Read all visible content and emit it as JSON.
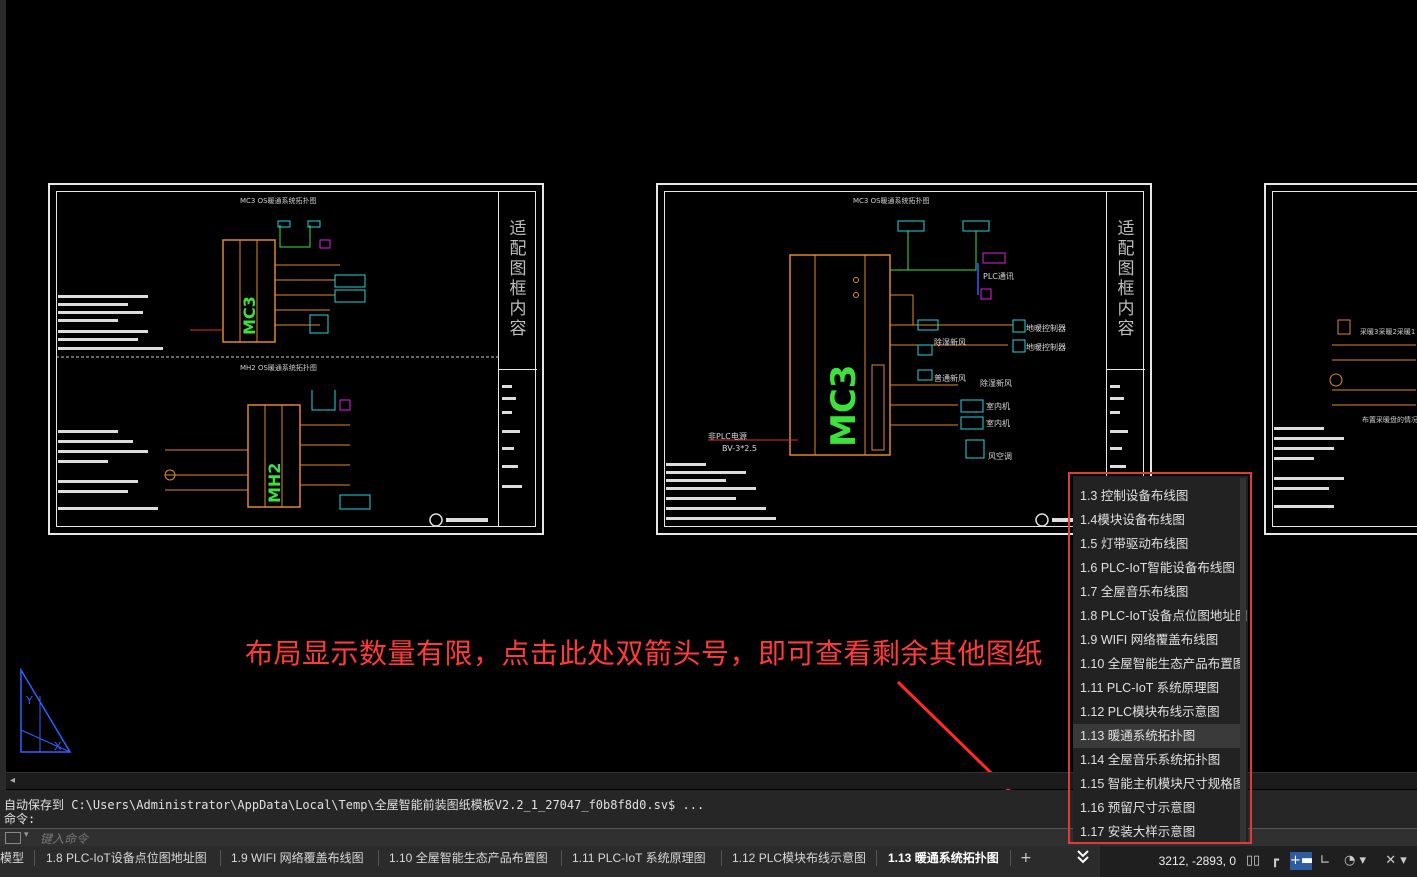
{
  "drawing": {
    "sheet1": {
      "title_top": "MC3 OS暖通系统拓扑图",
      "title_bottom": "MH2 OS暖通系统拓扑图",
      "module_top": "MC3",
      "module_bottom": "MH2",
      "title_column": "适配图框内容"
    },
    "sheet2": {
      "title": "MC3 OS暖通系统拓扑图",
      "module": "MC3",
      "title_column": "适配图框内容",
      "labels": {
        "plc": "PLC通讯",
        "floor1": "地暖控制器",
        "floor2": "地暖控制器",
        "fresh1": "除湿新风",
        "fresh2": "普通新风",
        "fresh3": "除湿新风",
        "indoor1": "室内机",
        "indoor2": "室内机",
        "ac": "风空调",
        "power": "非PLC电源",
        "cable": "BV-3*2.5"
      }
    },
    "sheet3": {
      "label1": "采暖3采暖2采暖1",
      "label2": "布置采暖盘的情况"
    }
  },
  "annotation": "布局显示数量有限，点击此处双箭头号，即可查看剩余其他图纸",
  "history": {
    "line1": "自动保存到 C:\\Users\\Administrator\\AppData\\Local\\Temp\\全屋智能前装图纸模板V2.2_1_27047_f0b8f8d0.sv$ ...",
    "line2": "命令:"
  },
  "command": {
    "placeholder": "键入命令"
  },
  "tabs": [
    {
      "label": "模型"
    },
    {
      "label": "1.8 PLC-IoT设备点位图地址图"
    },
    {
      "label": "1.9 WIFI 网络覆盖布线图"
    },
    {
      "label": "1.10 全屋智能生态产品布置图"
    },
    {
      "label": "1.11 PLC-IoT 系统原理图"
    },
    {
      "label": "1.12 PLC模块布线示意图"
    },
    {
      "label": "1.13 暖通系统拓扑图"
    }
  ],
  "plus_label": "+",
  "overflow_icon": "double-chevron-down-icon",
  "dropdown": [
    {
      "label": "1.3 控制设备布线图"
    },
    {
      "label": "1.4模块设备布线图"
    },
    {
      "label": "1.5 灯带驱动布线图"
    },
    {
      "label": "1.6 PLC-IoT智能设备布线图"
    },
    {
      "label": "1.7 全屋音乐布线图"
    },
    {
      "label": "1.8 PLC-IoT设备点位图地址图"
    },
    {
      "label": "1.9 WIFI 网络覆盖布线图"
    },
    {
      "label": "1.10 全屋智能生态产品布置图"
    },
    {
      "label": "1.11 PLC-IoT 系统原理图"
    },
    {
      "label": "1.12 PLC模块布线示意图"
    },
    {
      "label": "1.13 暖通系统拓扑图"
    },
    {
      "label": "1.14 全屋音乐系统拓扑图"
    },
    {
      "label": "1.15 智能主机模块尺寸规格图"
    },
    {
      "label": "1.16  预留尺寸示意图"
    },
    {
      "label": "1.17 安装大样示意图"
    }
  ],
  "status": {
    "coords": "3212, -2893, 0",
    "icons": [
      "grid-icon",
      "snap-icon",
      "ortho-icon",
      "polar-icon",
      "osnap-icon",
      "otrack-icon"
    ]
  },
  "colors": {
    "annotation": "#ff3a3a",
    "highlight_box": "#e23a3a",
    "orange": "#e0892a",
    "green": "#3ee03e",
    "cyan": "#21d4e0",
    "magenta": "#e020e0",
    "blue": "#3060ff"
  }
}
